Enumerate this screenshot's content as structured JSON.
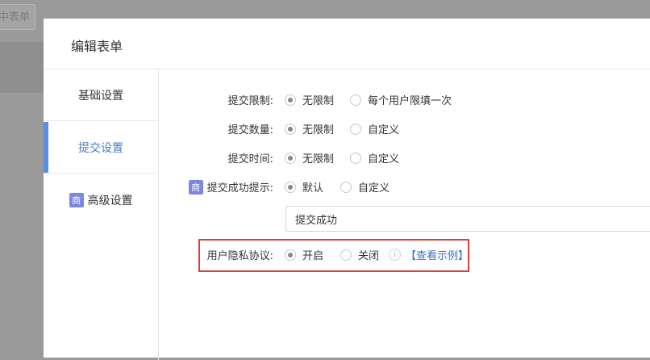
{
  "background": {
    "button_label": "中表单"
  },
  "modal": {
    "title": "编辑表单"
  },
  "sidebar": {
    "tabs": [
      {
        "label": "基础设置"
      },
      {
        "label": "提交设置"
      },
      {
        "label": "高级设置",
        "badge": "商"
      }
    ]
  },
  "form": {
    "submit_limit": {
      "label": "提交限制:",
      "options": [
        "无限制",
        "每个用户限填一次"
      ],
      "selected": "无限制"
    },
    "submit_count": {
      "label": "提交数量:",
      "options": [
        "无限制",
        "自定义"
      ],
      "selected": "无限制"
    },
    "submit_time": {
      "label": "提交时间:",
      "options": [
        "无限制",
        "自定义"
      ],
      "selected": "无限制"
    },
    "success_tip": {
      "badge": "商",
      "label": "提交成功提示:",
      "options": [
        "默认",
        "自定义"
      ],
      "selected": "默认",
      "input_value": "提交成功"
    },
    "privacy": {
      "label": "用户隐私协议:",
      "options": [
        "开启",
        "关闭"
      ],
      "selected": "开启",
      "info_icon": "i",
      "link": "【查看示例】"
    }
  },
  "colors": {
    "accent": "#4b7ccc",
    "active_bar": "#5a8de4",
    "badge": "#7c86e3",
    "highlight": "#d9413c",
    "link": "#3a6fc4"
  }
}
